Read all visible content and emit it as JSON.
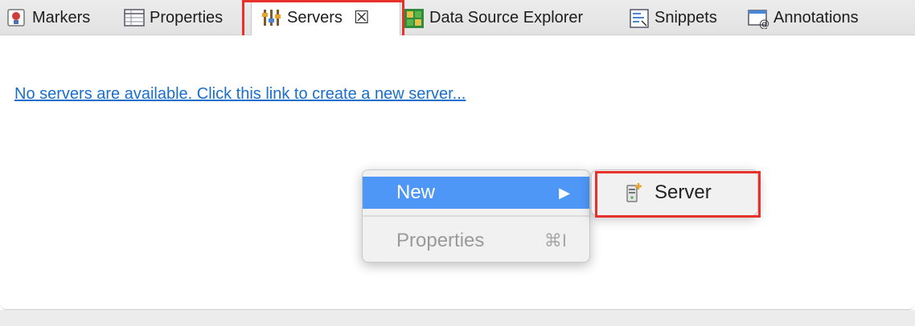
{
  "tabs": {
    "markers": "Markers",
    "properties": "Properties",
    "servers": "Servers",
    "data_source_explorer": "Data Source Explorer",
    "snippets": "Snippets",
    "annotations": "Annotations"
  },
  "content": {
    "link_text": "No servers are available. Click this link to create a new server..."
  },
  "context_menu": {
    "new_label": "New",
    "properties_label": "Properties",
    "properties_shortcut": "⌘I"
  },
  "submenu": {
    "server_label": "Server"
  },
  "colors": {
    "highlight": "#e8312a",
    "menu_selected": "#4f97f6",
    "link": "#1a6fcc"
  }
}
